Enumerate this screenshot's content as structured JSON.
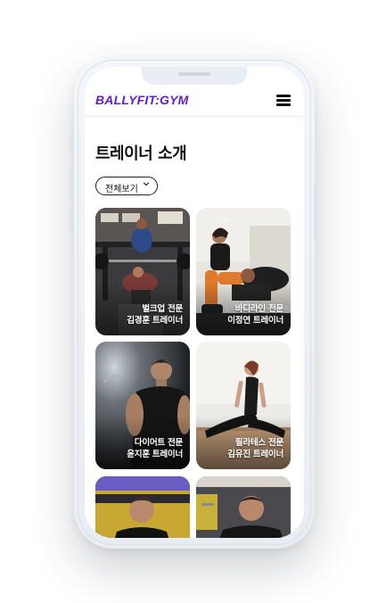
{
  "header": {
    "logo": "BALLYFIT:GYM"
  },
  "page": {
    "title": "트레이너 소개"
  },
  "filter": {
    "label": "전체보기"
  },
  "trainers": [
    {
      "specialty": "벌크업 전문",
      "name": "김경훈 트레이너"
    },
    {
      "specialty": "바디라인 전문",
      "name": "이정연 트레이너"
    },
    {
      "specialty": "다이어트 전문",
      "name": "윤지훈 트레이너"
    },
    {
      "specialty": "필라테스 전문",
      "name": "김유진 트레이너"
    },
    {
      "specialty": "",
      "name": ""
    },
    {
      "specialty": "",
      "name": ""
    }
  ],
  "icons": {
    "menu": "hamburger-menu-icon",
    "filter": "chevron-down-icon"
  },
  "colors": {
    "brand": "#6420c8",
    "text": "#111111"
  }
}
